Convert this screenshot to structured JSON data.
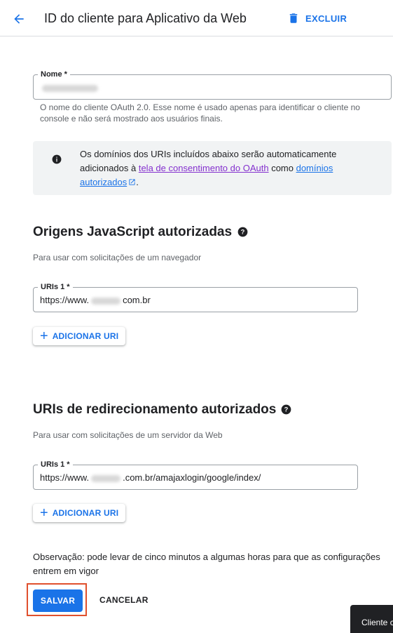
{
  "header": {
    "title": "ID do cliente para Aplicativo da Web",
    "delete_label": "EXCLUIR"
  },
  "name_field": {
    "label": "Nome *",
    "help": "O nome do cliente OAuth 2.0. Esse nome é usado apenas para identificar o cliente no console e não será mostrado aos usuários finais."
  },
  "info": {
    "text_before": "Os domínios dos URIs incluídos abaixo serão automaticamente adicionados à ",
    "consent_link": "tela de consentimento do OAuth",
    "text_middle": " como ",
    "domains_link": "domínios autorizados",
    "text_after": "."
  },
  "js_origins": {
    "title": "Origens JavaScript autorizadas",
    "subtitle": "Para usar com solicitações de um navegador",
    "uri_label": "URIs 1 *",
    "uri_prefix": "https://www.",
    "uri_suffix": "com.br",
    "add_label": "ADICIONAR URI"
  },
  "redirect_uris": {
    "title": "URIs de redirecionamento autorizados",
    "subtitle": "Para usar com solicitações de um servidor da Web",
    "uri_label": "URIs 1 *",
    "uri_prefix": "https://www.",
    "uri_suffix": ".com.br/amajaxlogin/google/index/",
    "add_label": "ADICIONAR URI"
  },
  "note": "Observação: pode levar de cinco minutos a algumas horas para que as configurações entrem em vigor",
  "actions": {
    "save_label": "SALVAR",
    "cancel_label": "CANCELAR"
  },
  "toast": {
    "text": "Cliente c"
  },
  "colors": {
    "accent": "#1a73e8",
    "highlight": "#e0502d",
    "visited_link": "#8430ce"
  }
}
